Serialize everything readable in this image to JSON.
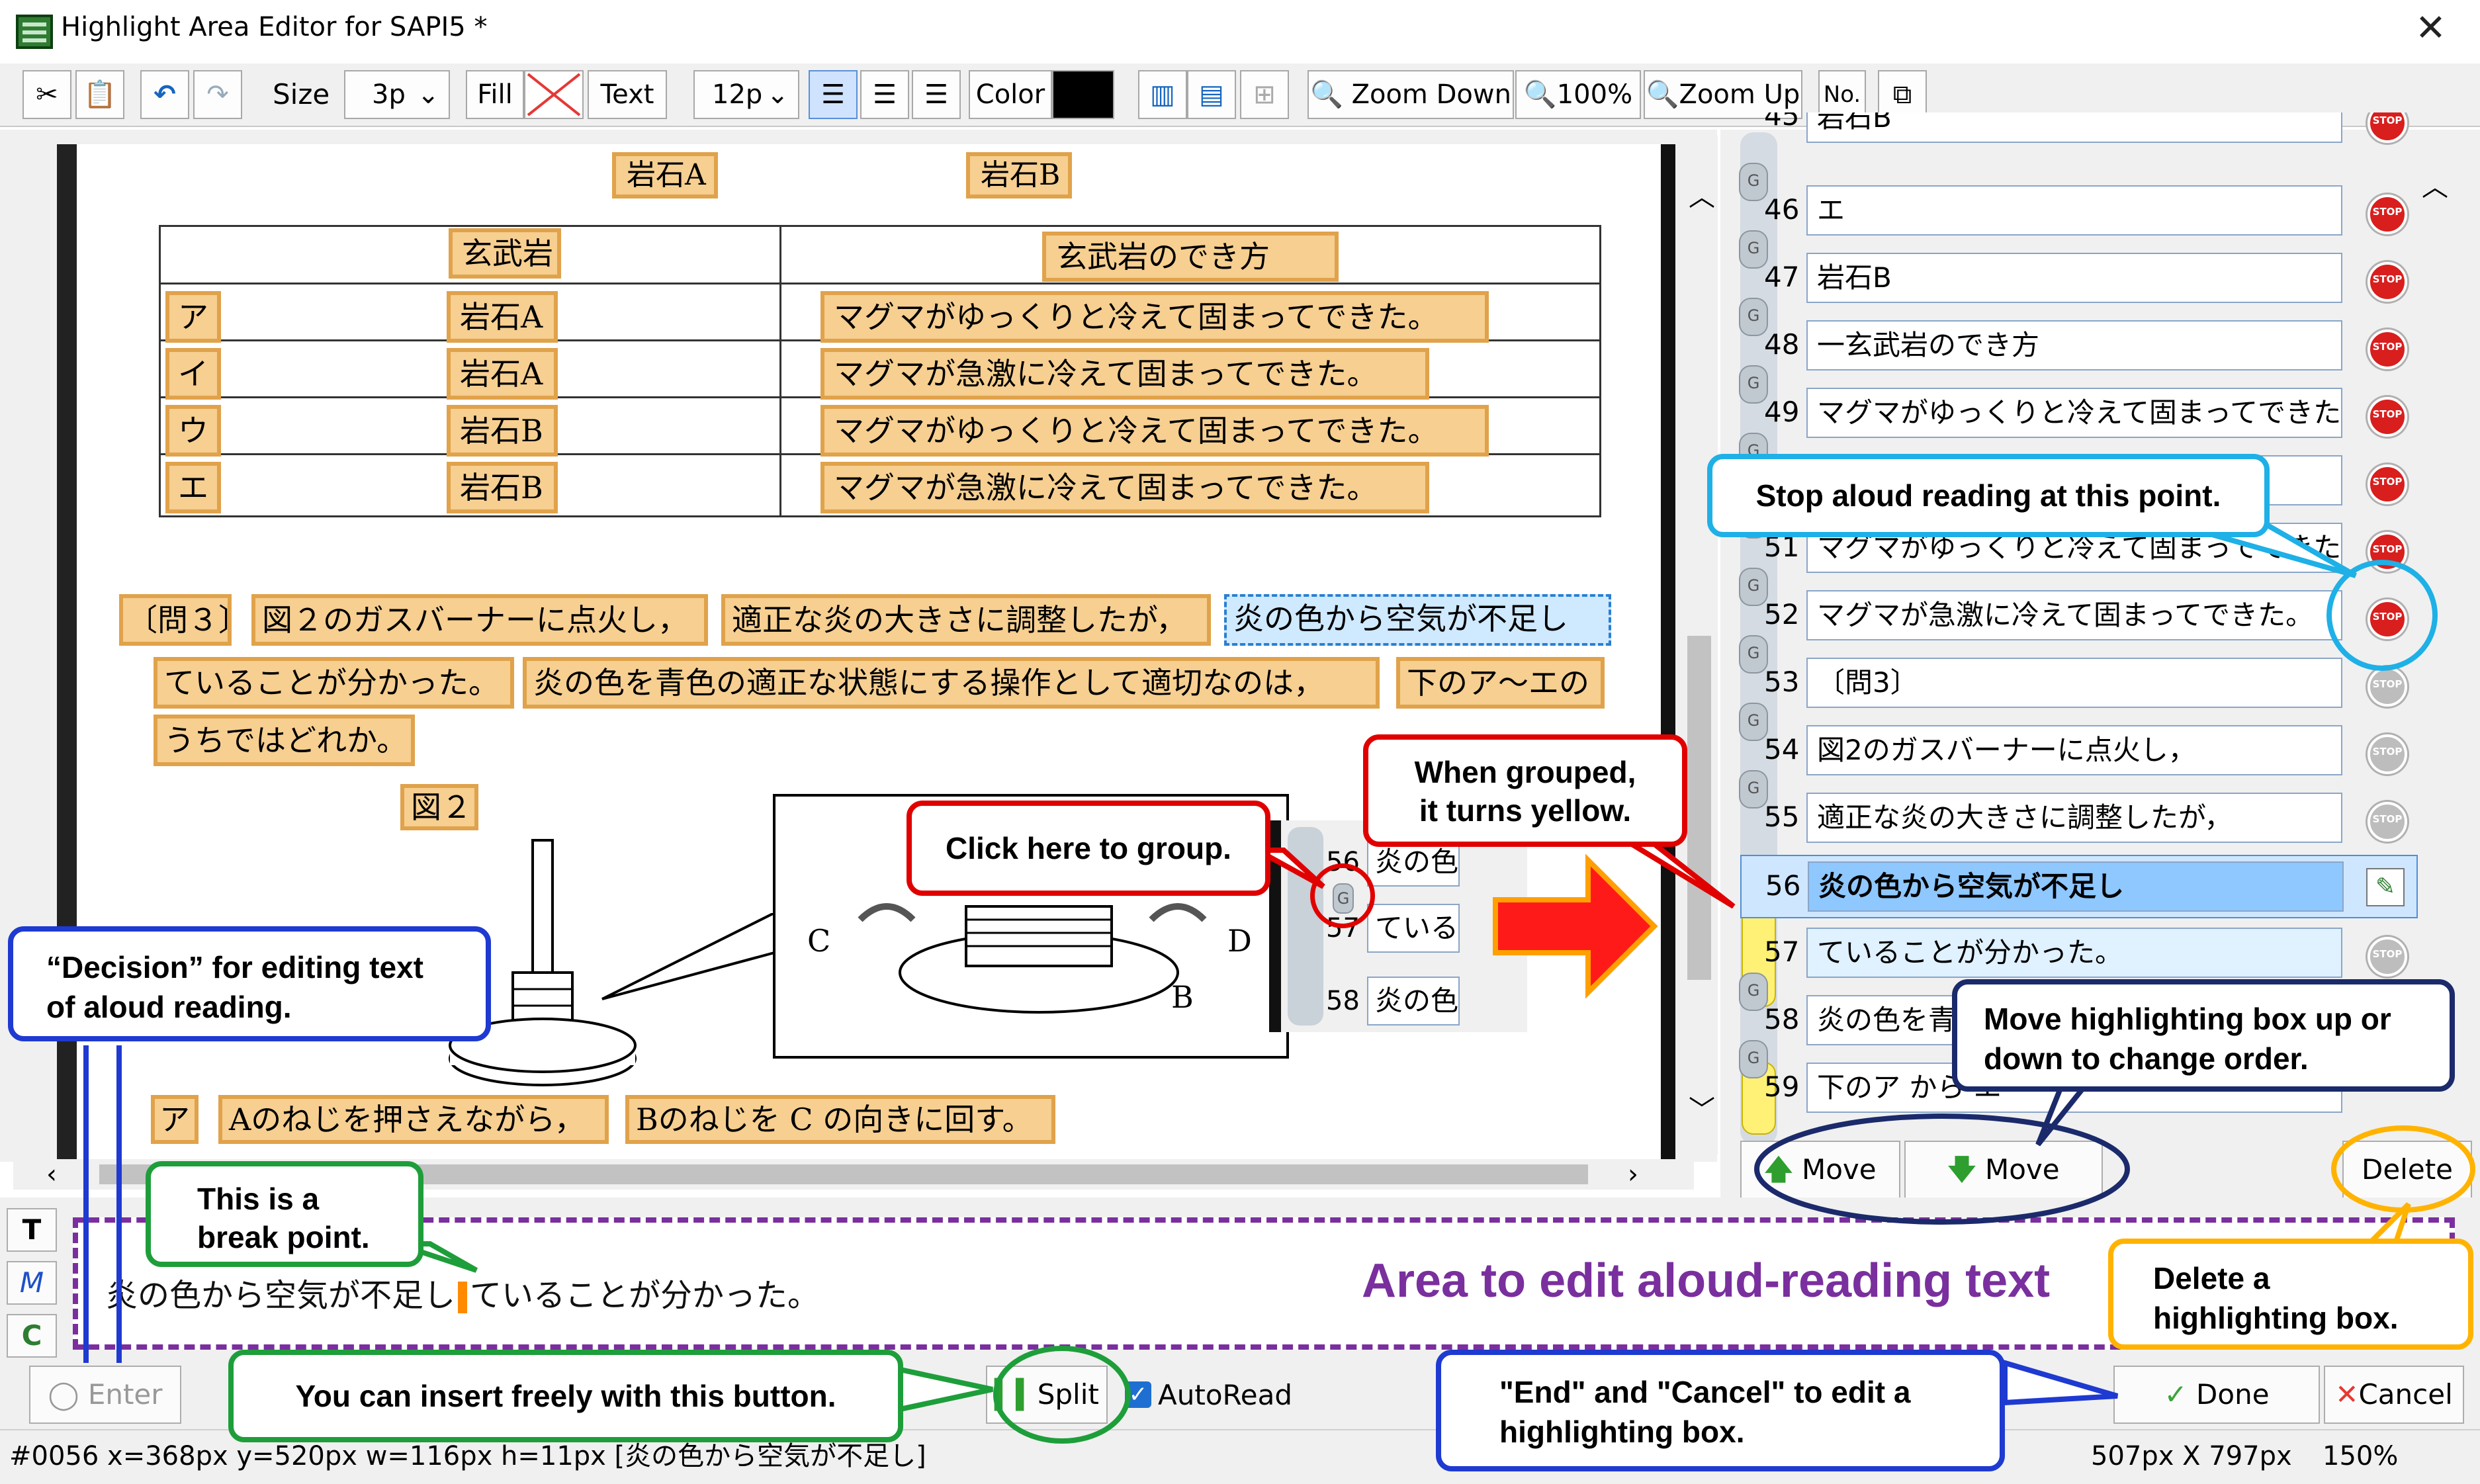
{
  "window": {
    "title": "Highlight Area Editor for SAPI5 *"
  },
  "toolbar": {
    "size_label": "Size",
    "size_value": "3p",
    "fill_label": "Fill",
    "text_label": "Text",
    "font_size_value": "12p",
    "color_label": "Color",
    "color_value": "#000000",
    "zoom_down": "Zoom Down",
    "zoom_value": "100%",
    "zoom_up": "Zoom Up",
    "number_label": "No."
  },
  "document": {
    "rock_a_header": "岩石A",
    "rock_b_header": "岩石B",
    "table_col1": "玄武岩",
    "table_col2": "玄武岩のでき方",
    "table_rows": [
      {
        "label": "ア",
        "rock": "岩石A",
        "desc": "マグマがゆっくりと冷えて固まってできた。"
      },
      {
        "label": "イ",
        "rock": "岩石A",
        "desc": "マグマが急激に冷えて固まってできた。"
      },
      {
        "label": "ウ",
        "rock": "岩石B",
        "desc": "マグマがゆっくりと冷えて固まってできた。"
      },
      {
        "label": "エ",
        "rock": "岩石B",
        "desc": "マグマが急激に冷えて固まってできた。"
      }
    ],
    "q3": "〔問３〕",
    "seg1": "図２のガスバーナーに点火し，",
    "seg2": "適正な炎の大きさに調整したが，",
    "seg3": "炎の色から空気が不足し",
    "seg4": "ていることが分かった。",
    "seg5": "炎の色を青色の適正な状態にする操作として適切なのは，",
    "seg6": "下のア～エの",
    "seg7": "うちではどれか。",
    "fig_label": "図２",
    "fig_c": "C",
    "fig_d": "D",
    "fig_b": "B",
    "answer_label": "ア",
    "answer1": "Aのねじを押さえながら，",
    "answer2": "Bのねじを C の向きに回す。",
    "inset_row56_num": "56",
    "inset_row56_text": "炎の色",
    "inset_row57_num": "57",
    "inset_row57_text": "ている",
    "inset_row58_num": "58",
    "inset_row58_text": "炎の色"
  },
  "list": {
    "rows": [
      {
        "num": "45",
        "text": "岩石B",
        "stop": true
      },
      {
        "num": "46",
        "text": "エ",
        "stop": true
      },
      {
        "num": "47",
        "text": "岩石B",
        "stop": true
      },
      {
        "num": "48",
        "text": "一玄武岩のでき方",
        "stop": true
      },
      {
        "num": "49",
        "text": "マグマがゆっくりと冷えて固まってできた。",
        "stop": true
      },
      {
        "num": "50",
        "text": "",
        "stop": true
      },
      {
        "num": "51",
        "text": "マグマがゆっくりと冷えて固まってできた。",
        "stop": true
      },
      {
        "num": "52",
        "text": "マグマが急激に冷えて固まってできた。",
        "stop": true
      },
      {
        "num": "53",
        "text": "〔問3〕",
        "stop": false
      },
      {
        "num": "54",
        "text": "図2のガスバーナーに点火し，",
        "stop": false
      },
      {
        "num": "55",
        "text": "適正な炎の大きさに調整したが，",
        "stop": false
      },
      {
        "num": "56",
        "text": "炎の色から空気が不足し",
        "stop": false
      },
      {
        "num": "57",
        "text": "ていることが分かった。",
        "stop": false
      },
      {
        "num": "58",
        "text": "炎の色を青",
        "stop": false
      },
      {
        "num": "59",
        "text": "下のア から エ",
        "stop": false
      }
    ],
    "move_up": "Move Up",
    "move_down": "Move Down",
    "delete": "Delete"
  },
  "editor": {
    "text_before": "炎の色から空気が不足し",
    "text_after": "ていることが分かった。",
    "mode_t": "T",
    "mode_m": "M",
    "mode_c": "C",
    "enter": "Enter",
    "split": "Split",
    "autoread": "AutoRead",
    "done": "Done",
    "cancel": "Cancel"
  },
  "status": {
    "left": "#0056 x=368px y=520px w=116px h=11px [炎の色から空気が不足し]",
    "size": "507px X 797px",
    "zoom": "150%"
  },
  "annotations": {
    "stop_reading": "Stop aloud reading at this point.",
    "grouped": "When grouped,\nit turns yellow.",
    "click_group": "Click here to group.",
    "decision": "“Decision” for editing text\nof aloud reading.",
    "break_point": "This is a\nbreak point.",
    "move_box": "Move highlighting box up or\ndown to change order.",
    "area_title": "Area to edit aloud-reading text",
    "delete_box": "Delete a\nhighlighting box.",
    "insert_free": "You can insert freely with this button.",
    "end_cancel": "\"End\" and \"Cancel\" to edit a\nhighlighting box."
  }
}
